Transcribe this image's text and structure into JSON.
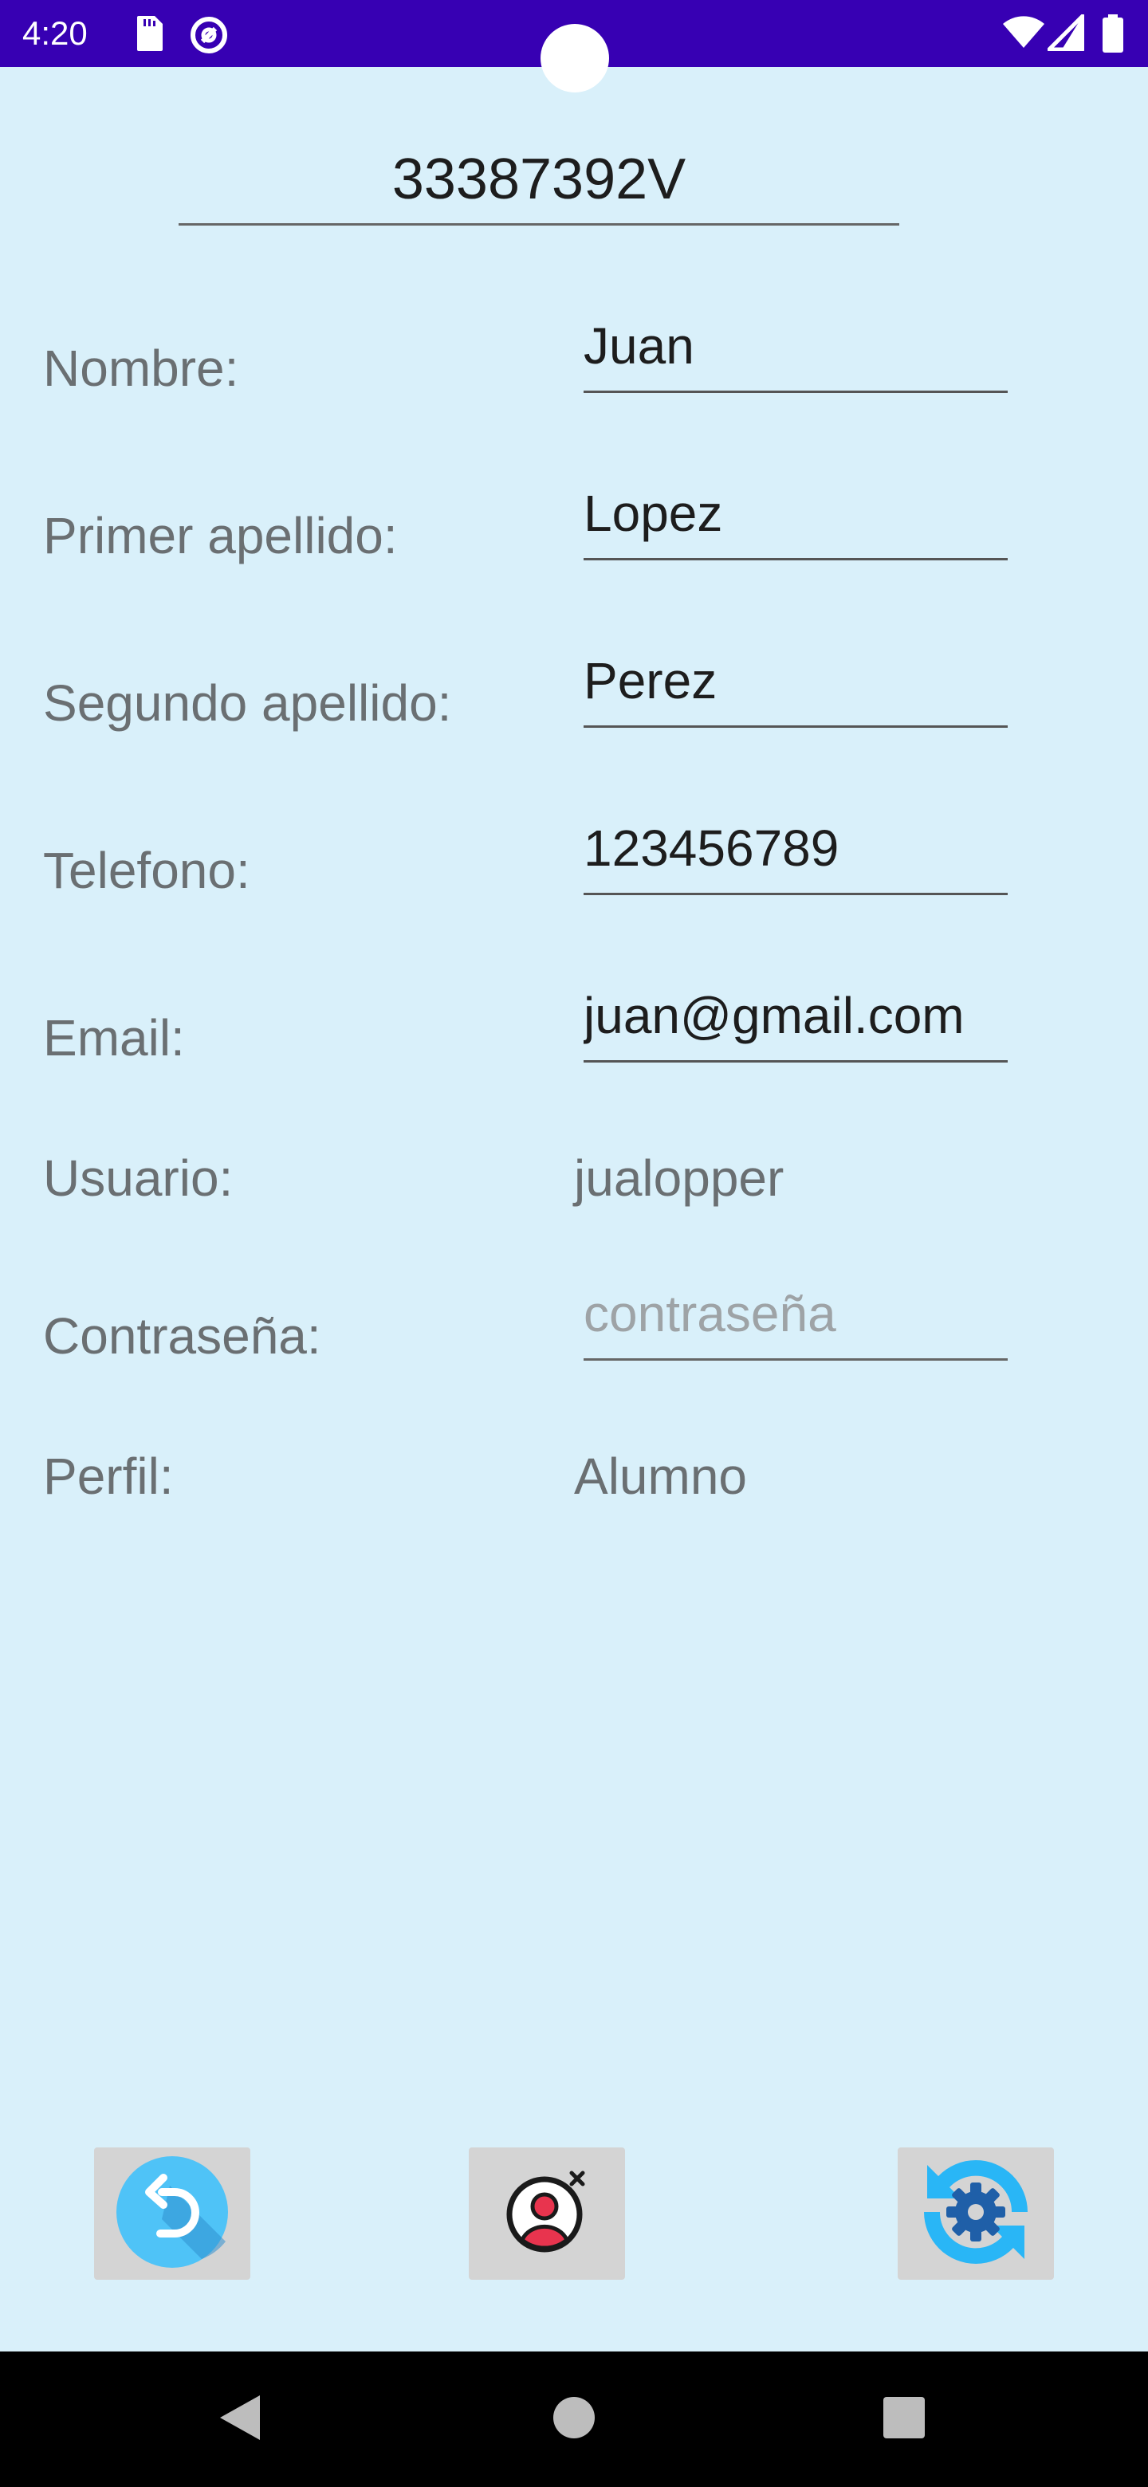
{
  "status_bar": {
    "time": "4:20",
    "left_icons": [
      "sd-card-icon",
      "data-saver-icon"
    ],
    "right_icons": [
      "wifi-icon",
      "signal-icon",
      "battery-icon"
    ],
    "background_color": "#3700b3"
  },
  "header": {
    "dni": "33387392V"
  },
  "form": {
    "nombre": {
      "label": "Nombre:",
      "value": "Juan"
    },
    "primer_apellido": {
      "label": "Primer apellido:",
      "value": "Lopez"
    },
    "segundo_apellido": {
      "label": "Segundo apellido:",
      "value": "Perez"
    },
    "telefono": {
      "label": "Telefono:",
      "value": "123456789"
    },
    "email": {
      "label": "Email:",
      "value": "juan@gmail.com"
    },
    "usuario": {
      "label": "Usuario:",
      "value": "jualopper"
    },
    "contrasena": {
      "label": "Contraseña:",
      "placeholder": "contraseña",
      "value": ""
    },
    "perfil": {
      "label": "Perfil:",
      "value": "Alumno"
    }
  },
  "actions": {
    "buttons": [
      "back-button",
      "delete-user-button",
      "update-settings-button"
    ]
  },
  "nav_bar": {
    "items": [
      "back",
      "home",
      "recents"
    ]
  }
}
